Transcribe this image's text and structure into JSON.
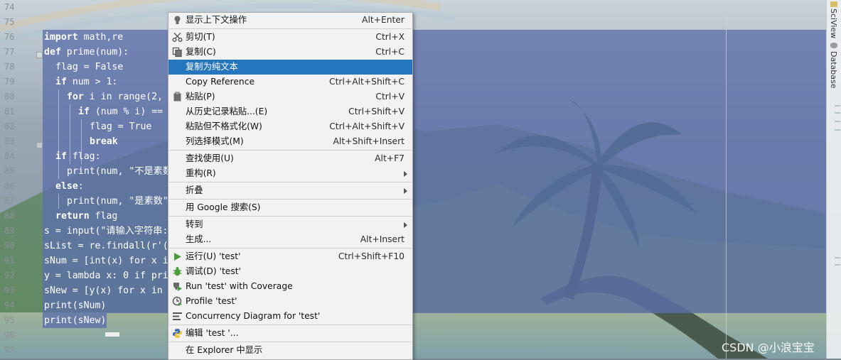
{
  "line_numbers": [
    "74",
    "75",
    "76",
    "77",
    "78",
    "79",
    "80",
    "81",
    "82",
    "83",
    "84",
    "85",
    "86",
    "87",
    "88",
    "89",
    "90",
    "91",
    "92",
    "93",
    "94",
    "95",
    "96",
    "97"
  ],
  "code_lines": [
    {
      "kw": "import",
      "rest": " math,re"
    },
    {
      "kw": "def",
      "rest": " prime(num):"
    },
    {
      "kw": "",
      "rest": "flag = False"
    },
    {
      "kw": "if",
      "rest": " num > 1:"
    },
    {
      "kw": "for",
      "rest": " i in range(2,"
    },
    {
      "kw": "if",
      "rest": " (num % i) =="
    },
    {
      "kw": "",
      "rest": "flag = True"
    },
    {
      "kw": "break",
      "rest": ""
    },
    {
      "kw": "if",
      "rest": " flag:"
    },
    {
      "kw": "",
      "rest": "print(num, \"不是素数"
    },
    {
      "kw": "else",
      "rest": ":"
    },
    {
      "kw": "",
      "rest": "print(num, \"是素数\""
    },
    {
      "kw": "return",
      "rest": " flag"
    },
    {
      "kw": "",
      "rest": "s = input(\"请输入字符串:"
    },
    {
      "kw": "",
      "rest": "sList = re.findall(r'("
    },
    {
      "kw": "",
      "rest": "sNum = [int(x) for x i"
    },
    {
      "kw": "",
      "rest": "y = lambda x: 0 if pri"
    },
    {
      "kw": "",
      "rest": "sNew = [y(x) for x in"
    },
    {
      "kw": "",
      "rest": "print(sNum)"
    },
    {
      "kw": "",
      "rest": "print(sNew)"
    }
  ],
  "right_tabs": {
    "sciview": "SciView",
    "database": "Database"
  },
  "context_menu": {
    "items": [
      {
        "label": "显示上下文操作",
        "shortcut": "Alt+Enter",
        "icon": "bulb-icon"
      },
      {
        "label": "剪切(T)",
        "shortcut": "Ctrl+X",
        "icon": "scissors-icon"
      },
      {
        "label": "复制(C)",
        "shortcut": "Ctrl+C",
        "icon": "copy-icon"
      },
      {
        "label": "复制为纯文本",
        "shortcut": "",
        "icon": ""
      },
      {
        "label": "Copy Reference",
        "shortcut": "Ctrl+Alt+Shift+C",
        "icon": ""
      },
      {
        "label": "粘贴(P)",
        "shortcut": "Ctrl+V",
        "icon": "clipboard-icon"
      },
      {
        "label": "从历史记录粘贴...(E)",
        "shortcut": "Ctrl+Shift+V",
        "icon": ""
      },
      {
        "label": "粘贴但不格式化(W)",
        "shortcut": "Ctrl+Alt+Shift+V",
        "icon": ""
      },
      {
        "label": "列选择模式(M)",
        "shortcut": "Alt+Shift+Insert",
        "icon": ""
      },
      {
        "label": "查找使用(U)",
        "shortcut": "Alt+F7",
        "icon": ""
      },
      {
        "label": "重构(R)",
        "shortcut": "",
        "icon": ""
      },
      {
        "label": "折叠",
        "shortcut": "",
        "icon": ""
      },
      {
        "label": "用 Google 搜索(S)",
        "shortcut": "",
        "icon": ""
      },
      {
        "label": "转到",
        "shortcut": "",
        "icon": ""
      },
      {
        "label": "生成...",
        "shortcut": "Alt+Insert",
        "icon": ""
      },
      {
        "label": "运行(U) 'test'",
        "shortcut": "Ctrl+Shift+F10",
        "icon": "run-icon"
      },
      {
        "label": "调试(D) 'test'",
        "shortcut": "",
        "icon": "debug-icon"
      },
      {
        "label": "Run 'test' with Coverage",
        "shortcut": "",
        "icon": "coverage-icon"
      },
      {
        "label": "Profile 'test'",
        "shortcut": "",
        "icon": "profile-icon"
      },
      {
        "label": "Concurrency Diagram for 'test'",
        "shortcut": "",
        "icon": "concurrency-icon"
      },
      {
        "label": "编辑 'test '...",
        "shortcut": "",
        "icon": "python-icon"
      },
      {
        "label": "在 Explorer 中显示",
        "shortcut": "",
        "icon": ""
      }
    ],
    "highlighted_index": 3,
    "submenu_indices": [
      10,
      11,
      13
    ]
  },
  "watermark": "CSDN @小浪宝宝",
  "colors": {
    "selection": "#5c70aa",
    "menu_highlight": "#2675bf",
    "menu_bg": "#f2f2f2"
  }
}
